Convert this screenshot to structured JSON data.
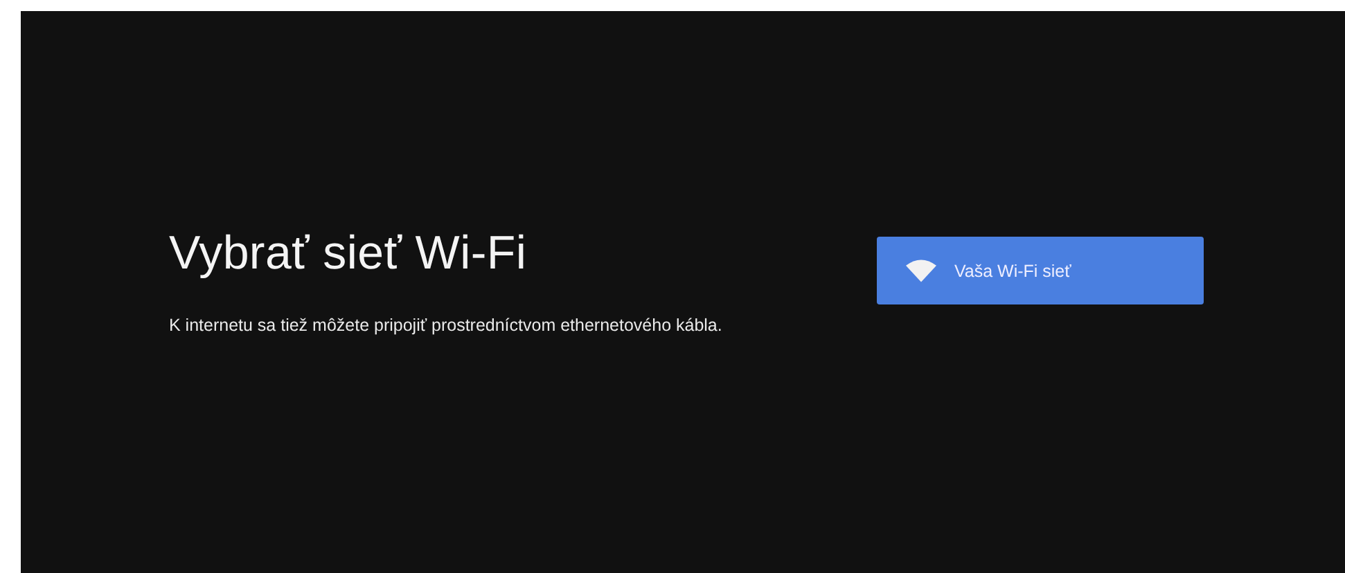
{
  "title": "Vybrať sieť Wi-Fi",
  "description": "K internetu sa tiež môžete pripojiť prostredníctvom ethernetového kábla.",
  "networks": [
    {
      "name": "Vaša Wi-Fi sieť",
      "selected": true
    }
  ]
}
